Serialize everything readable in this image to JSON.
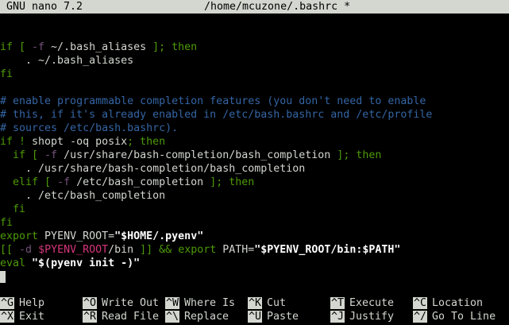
{
  "titlebar": {
    "app": "GNU nano 7.2",
    "file": "/home/mcuzone/.bashrc *"
  },
  "editor": {
    "lines": [
      [
        {
          "t": "",
          "c": "tx"
        }
      ],
      [
        {
          "t": "if [ ",
          "c": "kw"
        },
        {
          "t": "-f",
          "c": "tf"
        },
        {
          "t": " ~/.bash_aliases ",
          "c": "tx"
        },
        {
          "t": "]; then",
          "c": "kw"
        }
      ],
      [
        {
          "t": "    . ~/.bash_aliases",
          "c": "tx"
        }
      ],
      [
        {
          "t": "fi",
          "c": "kw"
        }
      ],
      [
        {
          "t": "",
          "c": "tx"
        }
      ],
      [
        {
          "t": "# enable programmable completion features (you don't need to enable",
          "c": "cm"
        }
      ],
      [
        {
          "t": "# this, if it's already enabled in /etc/bash.bashrc and /etc/profile",
          "c": "cm"
        }
      ],
      [
        {
          "t": "# sources /etc/bash.bashrc).",
          "c": "cm"
        }
      ],
      [
        {
          "t": "if ! ",
          "c": "kw"
        },
        {
          "t": "shopt -oq posix",
          "c": "tx"
        },
        {
          "t": "; then",
          "c": "kw"
        }
      ],
      [
        {
          "t": "  if [ ",
          "c": "kw"
        },
        {
          "t": "-f",
          "c": "tf"
        },
        {
          "t": " /usr/share/bash-completion/bash_completion ",
          "c": "tx"
        },
        {
          "t": "]; then",
          "c": "kw"
        }
      ],
      [
        {
          "t": "    . /usr/share/bash-completion/bash_completion",
          "c": "tx"
        }
      ],
      [
        {
          "t": "  elif [ ",
          "c": "kw"
        },
        {
          "t": "-f",
          "c": "tf"
        },
        {
          "t": " /etc/bash_completion ",
          "c": "tx"
        },
        {
          "t": "]; then",
          "c": "kw"
        }
      ],
      [
        {
          "t": "    . /etc/bash_completion",
          "c": "tx"
        }
      ],
      [
        {
          "t": "  fi",
          "c": "kw"
        }
      ],
      [
        {
          "t": "fi",
          "c": "kw"
        }
      ],
      [
        {
          "t": "export",
          "c": "kw"
        },
        {
          "t": " PYENV_ROOT=",
          "c": "tx"
        },
        {
          "t": "\"$HOME/.pyenv\"",
          "c": "st"
        }
      ],
      [
        {
          "t": "[[ ",
          "c": "kw"
        },
        {
          "t": "-d",
          "c": "tf"
        },
        {
          "t": " ",
          "c": "tx"
        },
        {
          "t": "$PYENV_ROOT",
          "c": "va"
        },
        {
          "t": "/bin ",
          "c": "tx"
        },
        {
          "t": "]] && export",
          "c": "kw"
        },
        {
          "t": " PATH=",
          "c": "tx"
        },
        {
          "t": "\"$PYENV_ROOT/bin:$PATH\"",
          "c": "st"
        }
      ],
      [
        {
          "t": "eval",
          "c": "kw"
        },
        {
          "t": " ",
          "c": "tx"
        },
        {
          "t": "\"$(pyenv init -)\"",
          "c": "st"
        }
      ],
      [
        {
          "t": "",
          "c": "tx"
        }
      ]
    ]
  },
  "shortcuts": [
    {
      "key": "^G",
      "label": "Help"
    },
    {
      "key": "^X",
      "label": "Exit"
    },
    {
      "key": "^O",
      "label": "Write Out"
    },
    {
      "key": "^R",
      "label": "Read File"
    },
    {
      "key": "^W",
      "label": "Where Is"
    },
    {
      "key": "^\\",
      "label": "Replace"
    },
    {
      "key": "^K",
      "label": "Cut"
    },
    {
      "key": "^U",
      "label": "Paste"
    },
    {
      "key": "^T",
      "label": "Execute"
    },
    {
      "key": "^J",
      "label": "Justify"
    },
    {
      "key": "^C",
      "label": "Location"
    },
    {
      "key": "^/",
      "label": "Go To Line"
    }
  ]
}
